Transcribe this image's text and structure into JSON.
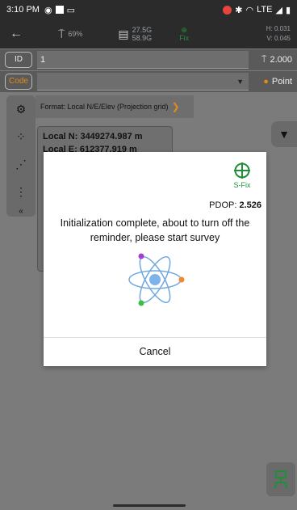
{
  "status_bar": {
    "time": "3:10 PM",
    "network": "LTE"
  },
  "toolbar": {
    "battery_percent": "69%",
    "storage_used": "27.5G",
    "storage_total": "58.9G",
    "fix_status": "Fix",
    "h_precision": "H: 0.031",
    "v_precision": "V: 0.045"
  },
  "id_row": {
    "label": "ID",
    "value": "1",
    "height_value": "2.000"
  },
  "code_row": {
    "label": "Code",
    "value": "",
    "point_label": "Point"
  },
  "format": {
    "text": "Format: Local N/E/Elev (Projection grid)"
  },
  "coords": {
    "local_n": "Local N: 3449274.987 m",
    "local_e": "Local E: 612377.919 m"
  },
  "dialog": {
    "status_text": "S-Fix",
    "pdop_label": "PDOP:",
    "pdop_value": "2.526",
    "message": "Initialization complete, about to turn off the reminder, please start survey",
    "cancel_label": "Cancel"
  },
  "colors": {
    "fix_green": "#1e8f3a",
    "accent_orange": "#e08a1a",
    "overlay": "#7b7b7b"
  }
}
